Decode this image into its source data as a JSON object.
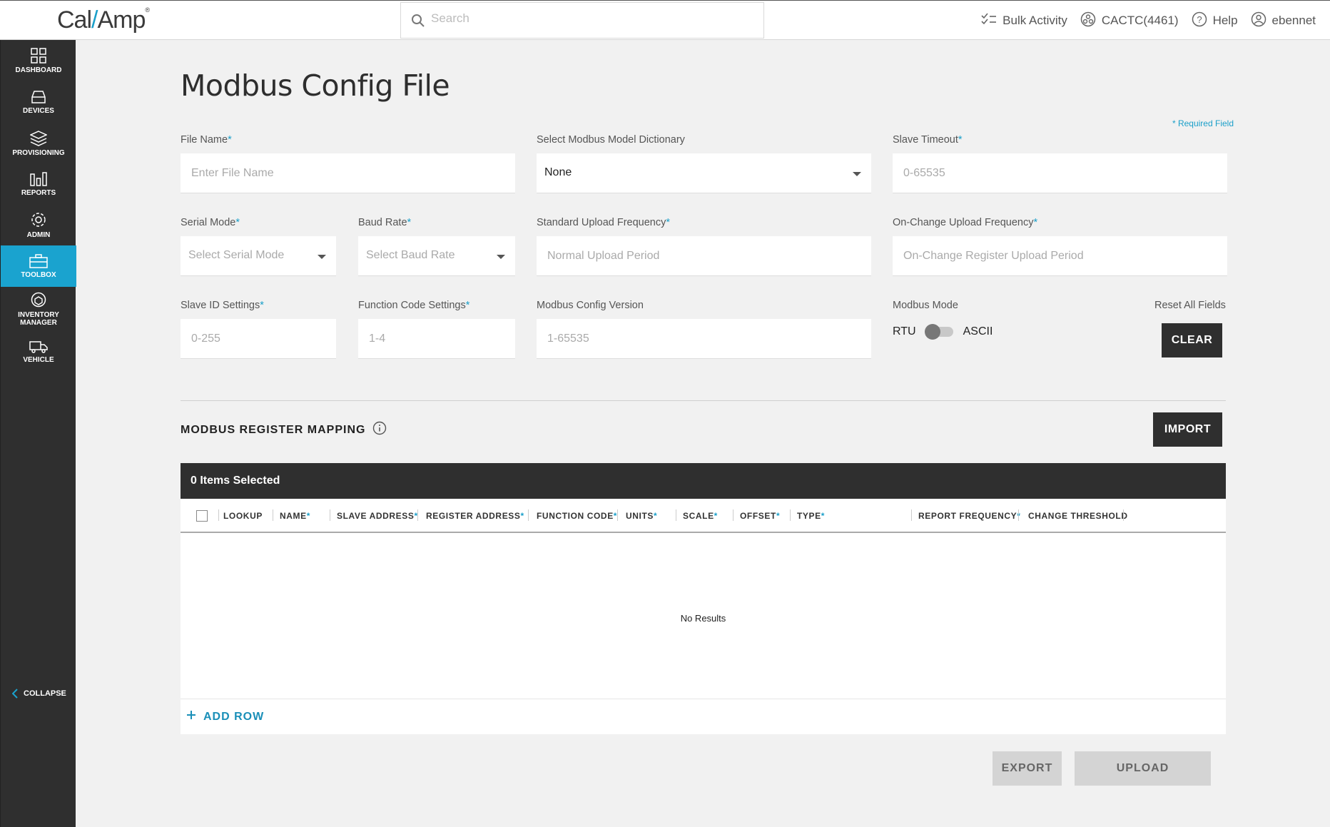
{
  "header": {
    "logo_left": "Cal",
    "logo_right": "Amp",
    "search_placeholder": "Search",
    "bulk_activity": "Bulk Activity",
    "account": "CACTC(4461)",
    "help": "Help",
    "user": "ebennet"
  },
  "sidebar": {
    "items": [
      {
        "label": "DASHBOARD",
        "icon": "dashboard-icon"
      },
      {
        "label": "DEVICES",
        "icon": "devices-icon"
      },
      {
        "label": "PROVISIONING",
        "icon": "layers-icon"
      },
      {
        "label": "REPORTS",
        "icon": "reports-icon"
      },
      {
        "label": "ADMIN",
        "icon": "gear-icon"
      },
      {
        "label": "TOOLBOX",
        "icon": "toolbox-icon"
      },
      {
        "label": "INVENTORY",
        "label2": "MANAGER",
        "icon": "inventory-icon"
      },
      {
        "label": "VEHICLE",
        "icon": "truck-icon"
      }
    ],
    "active": "TOOLBOX",
    "collapse": "COLLAPSE"
  },
  "page": {
    "title": "Modbus Config File",
    "required_note": "* Required Field"
  },
  "form": {
    "file_name": {
      "label": "File Name",
      "placeholder": "Enter File Name"
    },
    "model_dictionary": {
      "label": "Select Modbus Model Dictionary",
      "value": "None"
    },
    "slave_timeout": {
      "label": "Slave Timeout",
      "placeholder": "0-65535"
    },
    "serial_mode": {
      "label": "Serial Mode",
      "placeholder": "Select Serial Mode"
    },
    "baud_rate": {
      "label": "Baud Rate",
      "placeholder": "Select Baud Rate"
    },
    "standard_upload": {
      "label": "Standard Upload Frequency",
      "placeholder": "Normal Upload Period"
    },
    "onchange_upload": {
      "label": "On-Change Upload Frequency",
      "placeholder": "On-Change Register Upload Period"
    },
    "slave_id": {
      "label": "Slave ID Settings",
      "placeholder": "0-255"
    },
    "function_code": {
      "label": "Function Code Settings",
      "placeholder": "1-4"
    },
    "config_version": {
      "label": "Modbus Config Version",
      "placeholder": "1-65535"
    },
    "modbus_mode": {
      "label": "Modbus Mode",
      "left": "RTU",
      "right": "ASCII"
    },
    "reset_label": "Reset All Fields",
    "clear": "CLEAR"
  },
  "mapping": {
    "title": "MODBUS REGISTER MAPPING",
    "import": "IMPORT",
    "selected": "0 Items Selected",
    "columns": [
      {
        "label": "LOOKUP",
        "required": false
      },
      {
        "label": "NAME",
        "required": true
      },
      {
        "label": "SLAVE ADDRESS",
        "required": true
      },
      {
        "label": "REGISTER ADDRESS",
        "required": true
      },
      {
        "label": "FUNCTION CODE",
        "required": true
      },
      {
        "label": "UNITS",
        "required": true
      },
      {
        "label": "SCALE",
        "required": true
      },
      {
        "label": "OFFSET",
        "required": true
      },
      {
        "label": "TYPE",
        "required": true
      },
      {
        "label": "REPORT FREQUENCY",
        "required": true
      },
      {
        "label": "CHANGE THRESHOLD",
        "required": false
      }
    ],
    "empty": "No Results",
    "add_row": "ADD ROW"
  },
  "actions": {
    "export": "EXPORT",
    "upload": "UPLOAD"
  },
  "colors": {
    "accent": "#1aa3cf",
    "dark": "#2f2f2f"
  }
}
